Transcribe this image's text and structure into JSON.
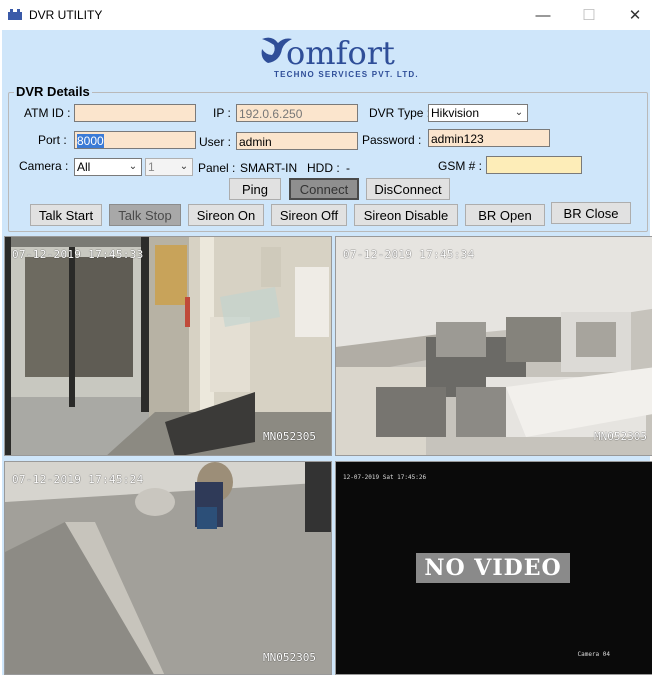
{
  "window": {
    "title": "DVR UTILITY",
    "min": "—",
    "max": "☐",
    "close": "✕"
  },
  "logo": {
    "name": "omfort",
    "sub": "TECHNO SERVICES PVT. LTD."
  },
  "details": {
    "group_label": "DVR Details",
    "atm_label": "ATM ID :",
    "atm_value": "",
    "ip_label": "IP :",
    "ip_value": "192.0.6.250",
    "dvr_type_label": "DVR Type :",
    "dvr_type_value": "Hikvision",
    "port_label": "Port :",
    "port_value": "8000",
    "user_label": "User :",
    "user_value": "admin",
    "password_label": "Password :",
    "password_value": "admin123",
    "camera_label": "Camera :",
    "camera_value": "All",
    "channel_value": "1",
    "panel_label": "Panel :",
    "panel_value": "SMART-IN",
    "hdd_label": "HDD :",
    "hdd_value": "-",
    "gsm_label": "GSM # :",
    "gsm_value": ""
  },
  "buttons": {
    "ping": "Ping",
    "connect": "Connect",
    "disconnect": "DisConnect",
    "talk_start": "Talk Start",
    "talk_stop": "Talk Stop",
    "sireon_on": "Sireon On",
    "sireon_off": "Sireon Off",
    "sireon_disable": "Sireon Disable",
    "br_open": "BR Open",
    "br_close": "BR Close"
  },
  "cameras": [
    {
      "timestamp": "07-12-2019 17:45:33",
      "id": "MN052305"
    },
    {
      "timestamp": "07-12-2019 17:45:34",
      "id": "MN052305"
    },
    {
      "timestamp": "07-12-2019 17:45:24",
      "id": "MN052305"
    },
    {
      "timestamp": "12-07-2019 Sat 17:45:26",
      "no_video": "NO VIDEO",
      "label": "Camera 04"
    }
  ]
}
